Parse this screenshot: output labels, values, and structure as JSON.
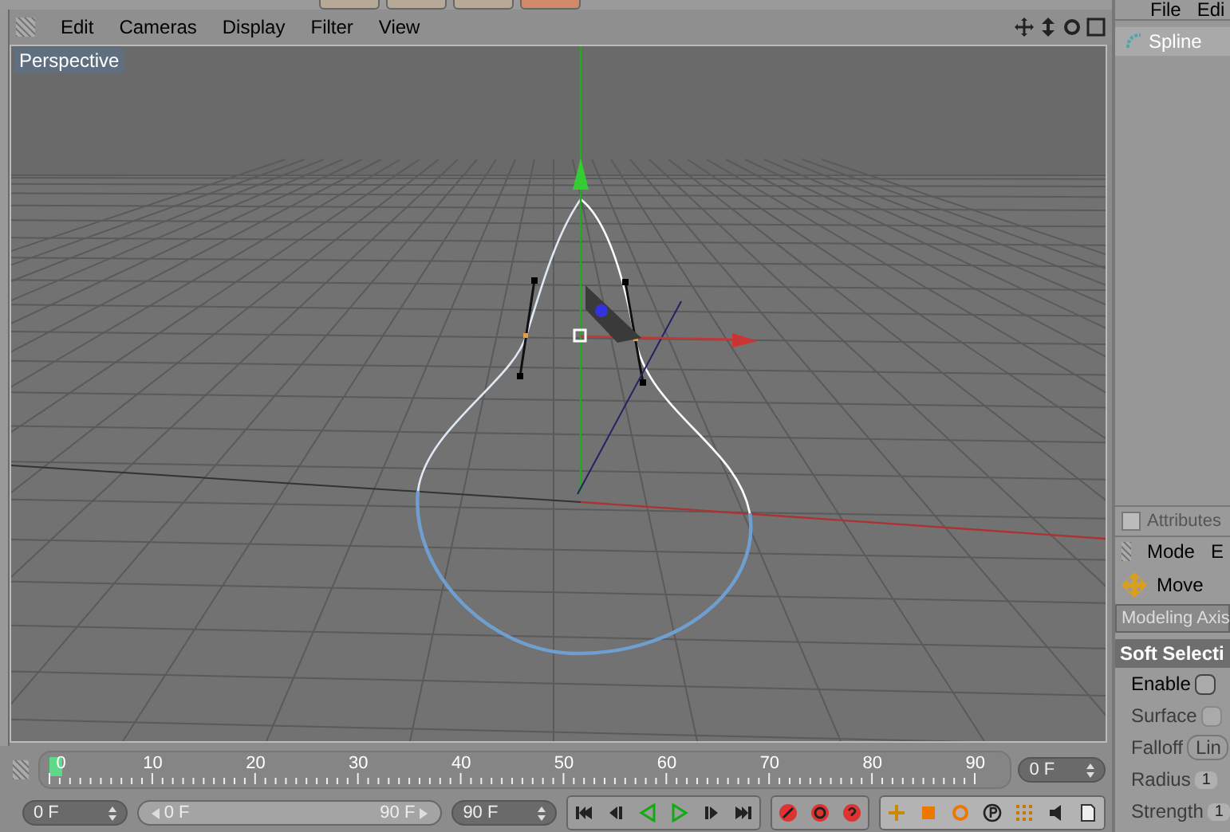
{
  "viewport": {
    "menu": [
      "Edit",
      "Cameras",
      "Display",
      "Filter",
      "View"
    ],
    "camera_label": "Perspective"
  },
  "timeline": {
    "labels": [
      "0",
      "10",
      "20",
      "30",
      "40",
      "50",
      "60",
      "70",
      "80",
      "90"
    ],
    "current_frame": "0 F"
  },
  "playback": {
    "start_field": "0 F",
    "range_start": "0 F",
    "level": 1,
    "range_end": "90 F",
    "end_field": "90 F"
  },
  "object_manager": {
    "menu": [
      "File",
      "Edi"
    ],
    "items": [
      {
        "name": "Spline",
        "selected": true
      }
    ]
  },
  "attributes": {
    "tab": "Attributes",
    "tab_checked": false,
    "menu": [
      "Mode",
      "E"
    ],
    "tool": "Move",
    "subtab": "Modeling Axis",
    "section": "Soft Selecti",
    "rows": [
      {
        "kind": "checkbox",
        "label": "Enable",
        "checked": false,
        "disabled": false
      },
      {
        "kind": "checkbox",
        "label": "Surface",
        "checked": false,
        "disabled": true
      },
      {
        "kind": "dropdown",
        "label": "Falloff",
        "value": "Lin",
        "disabled": true
      },
      {
        "kind": "number",
        "label": "Radius",
        "value": "1",
        "disabled": true
      },
      {
        "kind": "number",
        "label": "Strength",
        "value": "1",
        "disabled": true
      }
    ]
  }
}
